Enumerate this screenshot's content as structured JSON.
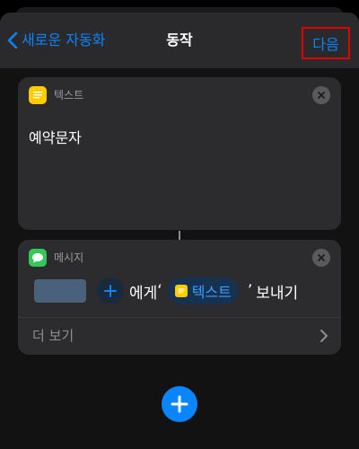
{
  "navbar": {
    "back_label": "새로운 자동화",
    "title": "동작",
    "next_label": "다음"
  },
  "text_action": {
    "header": "텍스트",
    "body": "예약문자"
  },
  "message_action": {
    "header": "메시지",
    "to_word": "에게",
    "open_quote": "‘",
    "variable_label": "텍스트",
    "close_quote": "’",
    "send_word": "보내기",
    "show_more_label": "더 보기"
  },
  "colors": {
    "accent": "#0a84ff",
    "highlight_box": "#e00000",
    "notes_icon": "#ffcc00",
    "messages_icon": "#34c759",
    "recipient_redacted": "#4a617c"
  },
  "icons": {
    "back": "chevron-left-icon",
    "notes": "notes-app-icon",
    "messages": "messages-app-icon",
    "close": "close-icon",
    "add": "plus-icon",
    "more": "chevron-right-icon"
  }
}
